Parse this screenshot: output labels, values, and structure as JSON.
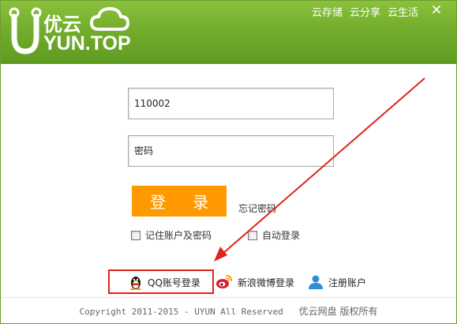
{
  "brand": {
    "logo_cn": "优云",
    "logo_en": "YUN.TOP",
    "colors": {
      "header_green": "#73ad2c",
      "accent_orange": "#ff9900",
      "highlight_red": "#e0231c"
    }
  },
  "topnav": {
    "items": [
      "云存储",
      "云分享",
      "云生活"
    ]
  },
  "window": {
    "close_icon": "close-icon"
  },
  "login": {
    "username_value": "110002",
    "password_placeholder": "密码",
    "login_button": "登 录",
    "forgot_password": "忘记密码",
    "remember_label": "记住账户及密码",
    "auto_login_label": "自动登录"
  },
  "social": {
    "qq_label": "QQ账号登录",
    "weibo_label": "新浪微博登录",
    "register_label": "注册账户",
    "icons": [
      "qq-penguin-icon",
      "weibo-icon",
      "user-icon"
    ]
  },
  "footer": {
    "copyright": "Copyright 2011-2015 - UYUN All Reserved",
    "rights_cn": "优云网盘 版权所有"
  }
}
